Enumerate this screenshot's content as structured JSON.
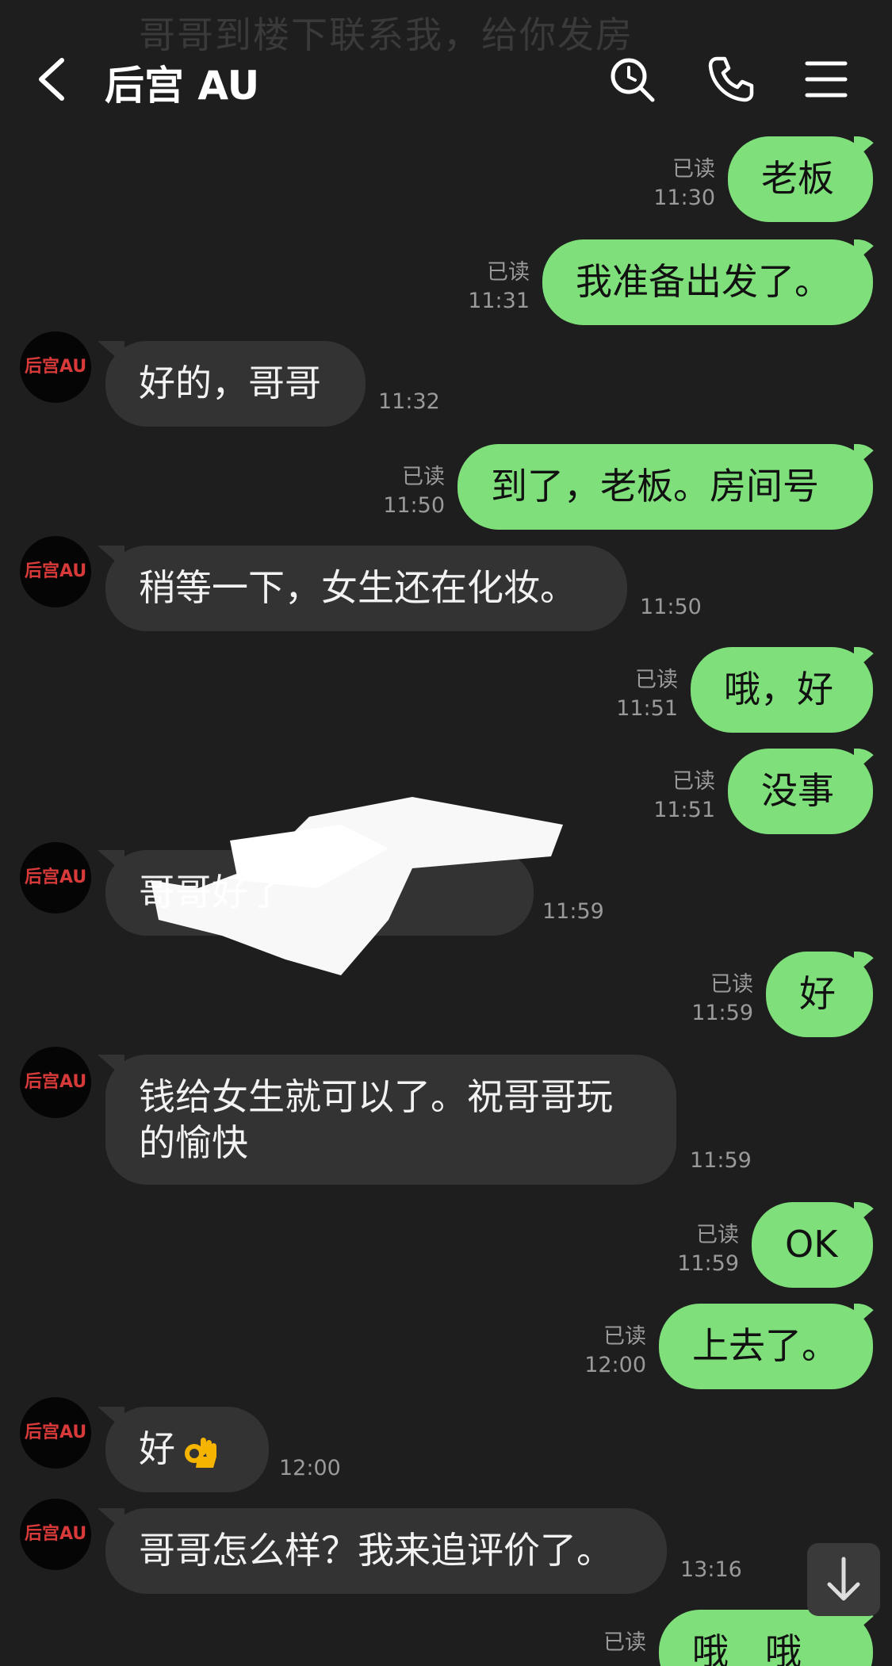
{
  "header": {
    "title": "后宫 AU",
    "banner_hint": "哥哥到楼下联系我，给你发房"
  },
  "contact": {
    "avatar_label": "后宫AU"
  },
  "messages": [
    {
      "dir": "out",
      "text": "老板",
      "read": "已读",
      "time": "11:30"
    },
    {
      "dir": "out",
      "text": "我准备出发了。",
      "read": "已读",
      "time": "11:31"
    },
    {
      "dir": "in",
      "text": "好的，哥哥",
      "time": "11:32"
    },
    {
      "dir": "out",
      "text": "到了，老板。房间号",
      "read": "已读",
      "time": "11:50"
    },
    {
      "dir": "in",
      "text": "稍等一下，女生还在化妆。",
      "time": "11:50"
    },
    {
      "dir": "out",
      "text": "哦，好",
      "read": "已读",
      "time": "11:51"
    },
    {
      "dir": "out",
      "text": "没事",
      "read": "已读",
      "time": "11:51"
    },
    {
      "dir": "in",
      "text": "哥哥好了",
      "time": "11:59"
    },
    {
      "dir": "out",
      "text": "好",
      "read": "已读",
      "time": "11:59"
    },
    {
      "dir": "in",
      "text_line1": "钱给女生就可以了。祝哥哥玩",
      "text_line2": "的愉快",
      "time": "11:59"
    },
    {
      "dir": "out",
      "text": "OK",
      "read": "已读",
      "time": "11:59"
    },
    {
      "dir": "out",
      "text": "上去了。",
      "read": "已读",
      "time": "12:00"
    },
    {
      "dir": "in",
      "text": "好",
      "emoji": "ok-hand",
      "time": "12:00"
    },
    {
      "dir": "in",
      "text": "哥哥怎么样？我来追评价了。",
      "time": "13:16"
    },
    {
      "dir": "out",
      "text": "哦　哦",
      "read": "已读"
    }
  ],
  "colors": {
    "background": "#1e1e1e",
    "outgoing_bubble": "#7fe07b",
    "incoming_bubble": "#333333",
    "meta_text": "#9a9a9a"
  }
}
